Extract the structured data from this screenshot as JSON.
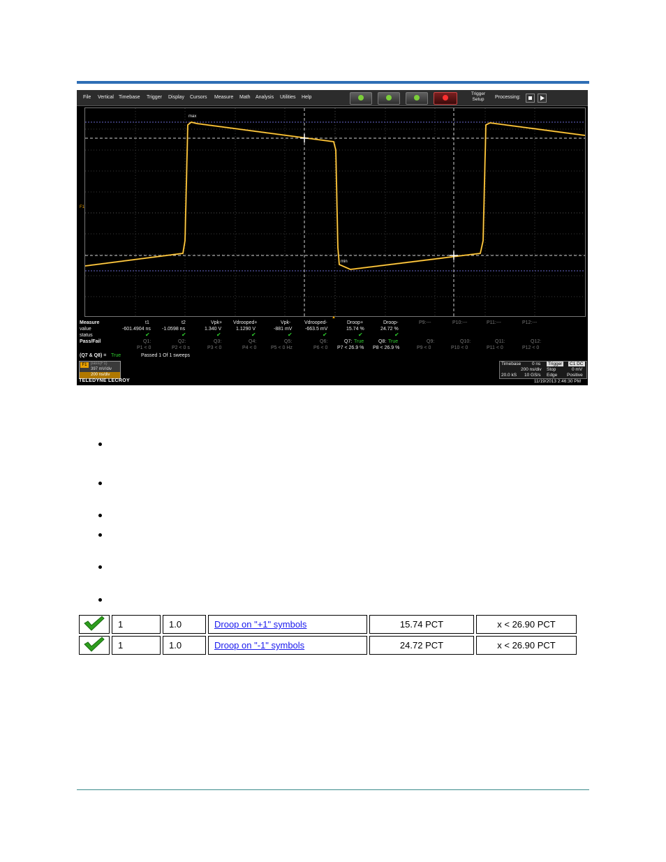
{
  "menu": [
    "File",
    "Vertical",
    "Timebase",
    "Trigger",
    "Display",
    "Cursors",
    "Measure",
    "Math",
    "Analysis",
    "Utilities",
    "Help"
  ],
  "toolbar": {
    "trigger_setup_line1": "Trigger",
    "trigger_setup_line2": "Setup",
    "processing_label": "Processing:"
  },
  "waveform": {
    "max_label": "max",
    "min_label": "min",
    "channel_marker": "F1",
    "color": "#e8a000"
  },
  "measure": {
    "row_labels": [
      "Measure",
      "value",
      "status",
      "Pass/Fail"
    ],
    "columns": [
      {
        "name": "t1",
        "value": "-601.4904 ns",
        "status": "ok",
        "q": "Q1:",
        "p": "P1 < 0"
      },
      {
        "name": "t2",
        "value": "-1.0598 ns",
        "status": "ok",
        "q": "Q2:",
        "p": "P2 < 0 s"
      },
      {
        "name": "Vpk+",
        "value": "1.340 V",
        "status": "ok",
        "q": "Q3:",
        "p": "P3 < 0"
      },
      {
        "name": "Vdrooped+",
        "value": "1.1290 V",
        "status": "ok",
        "q": "Q4:",
        "p": "P4 < 0"
      },
      {
        "name": "Vpk-",
        "value": "-881 mV",
        "status": "ok",
        "q": "Q5:",
        "p": "P5 < 0 Hz"
      },
      {
        "name": "Vdrooped-",
        "value": "-663.5 mV",
        "status": "ok",
        "q": "Q6:",
        "p": "P6 < 0"
      },
      {
        "name": "Droop+",
        "value": "15.74 %",
        "status": "ok",
        "q": "Q7:",
        "q_result": "True",
        "p": "P7 < 26.9 %"
      },
      {
        "name": "Droop-",
        "value": "24.72 %",
        "status": "ok",
        "q": "Q8:",
        "q_result": "True",
        "p": "P8 < 26.9 %"
      },
      {
        "name": "P9:---",
        "value": "",
        "status": "",
        "q": "Q9:",
        "p": "P9 < 0"
      },
      {
        "name": "P10:---",
        "value": "",
        "status": "",
        "q": "Q10:",
        "p": "P10 < 0"
      },
      {
        "name": "P11:---",
        "value": "",
        "status": "",
        "q": "Q11:",
        "p": "P11 < 0"
      },
      {
        "name": "P12:---",
        "value": "",
        "status": "",
        "q": "Q12:",
        "p": "P12 < 0"
      }
    ],
    "summary_expr": "(Q7 & Q8) =",
    "summary_result": "True",
    "summary_text": "Passed  1   Of  1   sweeps"
  },
  "f1_box": {
    "tag": "F1",
    "line1": "pass(F1)",
    "line2": "397 mV/div",
    "line3": "200 ns/div"
  },
  "timebase": {
    "label": "Timebase",
    "offset": "0 ns",
    "per_div": "200 ns/div",
    "samples": "20.0 kS",
    "rate": "10 GS/s"
  },
  "trigger": {
    "label": "Trigger",
    "ch": "C1 DC",
    "mode": "Stop",
    "level": "0 mV",
    "type": "Edge",
    "slope": "Positive"
  },
  "brand": "TELEDYNE LECROY",
  "datetime": "11/19/2013 2:46:30 PM",
  "results": [
    {
      "num": "1",
      "ver": "1.0",
      "link": "Droop on \"+1\" symbols",
      "value": "15.74 PCT",
      "limit": "x < 26.90 PCT"
    },
    {
      "num": "1",
      "ver": "1.0",
      "link": "Droop on \"-1\" symbols",
      "value": "24.72 PCT",
      "limit": "x < 26.90 PCT"
    }
  ],
  "colors": {
    "accent_rule": "#2e6eb5",
    "check_green": "#2e9e1e",
    "link": "#1a1aee"
  }
}
